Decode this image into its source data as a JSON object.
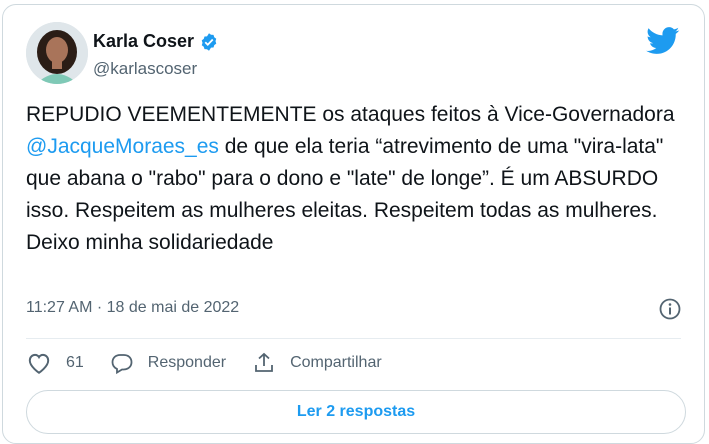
{
  "author": {
    "display_name": "Karla Coser",
    "handle": "@karlascoser"
  },
  "tweet": {
    "text_before": "REPUDIO VEEMENTEMENTE os ataques feitos à Vice-Governadora ",
    "mention": "@JacqueMoraes_es",
    "text_after": " de que ela teria “atrevimento de uma \"vira-lata\" que abana o \"rabo\" para o dono e \"late\" de longe”. É um ABSURDO isso. Respeitem as mulheres eleitas. Respeitem todas as mulheres. Deixo minha solidariedade",
    "timestamp": "11:27 AM · 18 de mai de 2022"
  },
  "actions": {
    "like_count": "61",
    "reply_label": "Responder",
    "share_label": "Compartilhar"
  },
  "replies_button_label": "Ler 2 respostas",
  "icons": {
    "brand": "twitter-bird-icon",
    "verified": "verified-badge-icon",
    "info": "info-icon",
    "like": "heart-icon",
    "reply": "speech-bubble-icon",
    "share": "share-upload-icon"
  },
  "colors": {
    "brand_blue": "#1d9bf0",
    "text": "#0f1419",
    "secondary_text": "#536471",
    "border": "#cfd9de"
  }
}
